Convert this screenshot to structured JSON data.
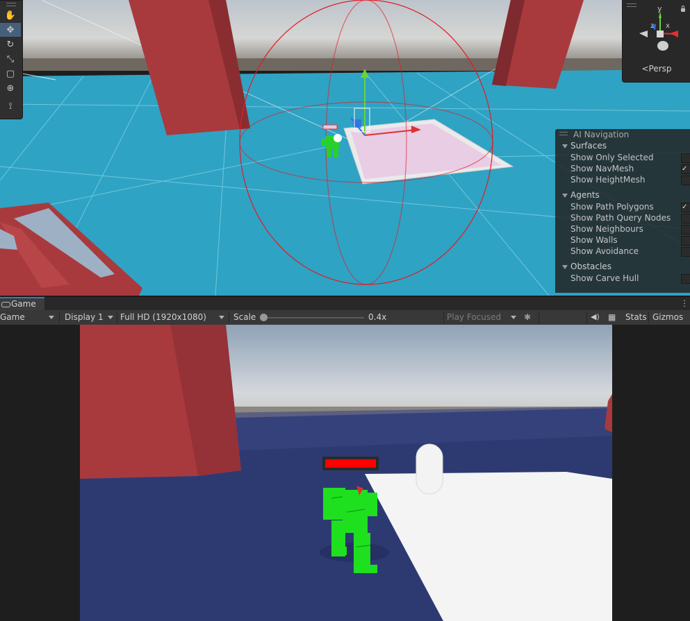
{
  "scene_view": {
    "toolbar": {
      "tools": [
        {
          "name": "hand-tool",
          "glyph": "✋"
        },
        {
          "name": "move-tool",
          "glyph": "✥",
          "active": true
        },
        {
          "name": "rotate-tool",
          "glyph": "↻"
        },
        {
          "name": "scale-tool",
          "glyph": "⤡"
        },
        {
          "name": "rect-tool",
          "glyph": "▢"
        },
        {
          "name": "transform-tool",
          "glyph": "⊕"
        },
        {
          "name": "custom-tool",
          "glyph": "⟟"
        }
      ]
    },
    "orientation_gizmo": {
      "projection_label": "Persp",
      "axes": {
        "y": "y",
        "z": "z",
        "x": "x"
      }
    },
    "ai_navigation_overlay": {
      "title": "AI Navigation",
      "sections": [
        {
          "label": "Surfaces",
          "items": [
            {
              "label": "Show Only Selected",
              "checked": false
            },
            {
              "label": "Show NavMesh",
              "checked": true
            },
            {
              "label": "Show HeightMesh",
              "checked": false
            }
          ]
        },
        {
          "label": "Agents",
          "items": [
            {
              "label": "Show Path Polygons",
              "checked": true
            },
            {
              "label": "Show Path Query Nodes",
              "checked": false
            },
            {
              "label": "Show Neighbours",
              "checked": false
            },
            {
              "label": "Show Walls",
              "checked": false
            },
            {
              "label": "Show Avoidance",
              "checked": false
            }
          ]
        },
        {
          "label": "Obstacles",
          "items": [
            {
              "label": "Show Carve Hull",
              "checked": false
            }
          ]
        }
      ]
    }
  },
  "game_tab": {
    "label": "Game",
    "more_menu": "⋮"
  },
  "game_toolbar": {
    "view_mode": "Game",
    "display": "Display 1",
    "resolution": "Full HD (1920x1080)",
    "scale_label": "Scale",
    "scale_value": "0.4x",
    "scale_fraction": 0.0,
    "play_mode": "Play Focused",
    "stats_label": "Stats",
    "gizmos_label": "Gizmos"
  },
  "colors": {
    "floor_scene": "#2fa3c4",
    "pillar_red": "#a83a3e",
    "floor_game": "#2d3a72",
    "health_bar": "#ff0000",
    "robot_green": "#1fe01f",
    "accent_tab": "#3a79bb"
  }
}
